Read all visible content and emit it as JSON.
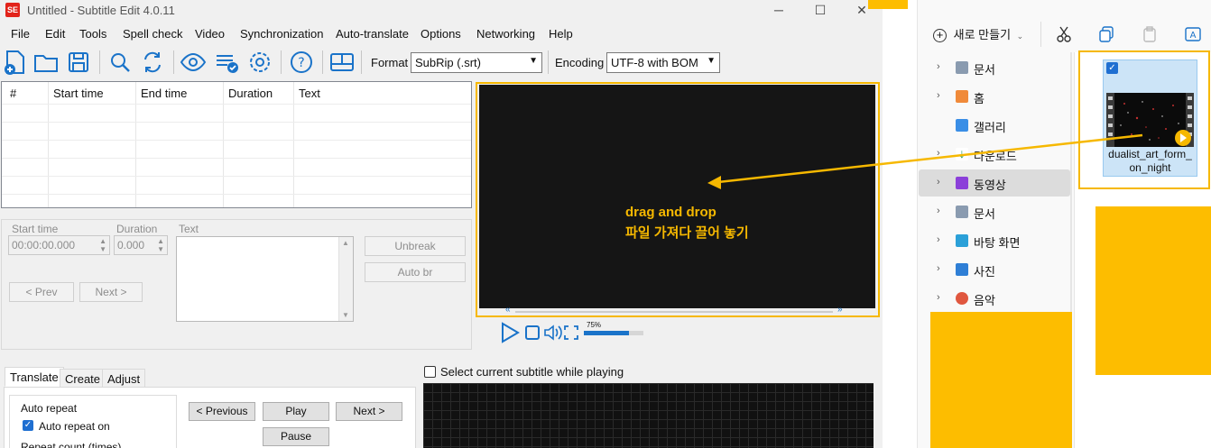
{
  "window": {
    "title": "Untitled - Subtitle Edit 4.0.11",
    "logo": "SE"
  },
  "menu": [
    "File",
    "Edit",
    "Tools",
    "Spell check",
    "Video",
    "Synchronization",
    "Auto-translate",
    "Options",
    "Networking",
    "Help"
  ],
  "toolbar": {
    "format_label": "Format",
    "format_value": "SubRip (.srt)",
    "encoding_label": "Encoding",
    "encoding_value": "UTF-8 with BOM"
  },
  "grid": {
    "headers": [
      "#",
      "Start time",
      "End time",
      "Duration",
      "Text"
    ]
  },
  "edit": {
    "start_time_label": "Start time",
    "start_time_value": "00:00:00.000",
    "duration_label": "Duration",
    "duration_value": "0.000",
    "text_label": "Text",
    "unbreak": "Unbreak",
    "auto_br": "Auto br",
    "prev": "< Prev",
    "next": "Next >"
  },
  "video": {
    "overlay_line1": "drag and drop",
    "overlay_line2": "파일 가져다 끌어 놓기",
    "volume": "75%",
    "volume_level": 0.75
  },
  "tabs": [
    "Translate",
    "Create",
    "Adjust"
  ],
  "translate": {
    "auto_repeat_group": "Auto repeat",
    "auto_repeat_on": "Auto repeat on",
    "repeat_count": "Repeat count (times)",
    "previous": "< Previous",
    "play": "Play",
    "next": "Next >",
    "pause": "Pause"
  },
  "waveform": {
    "select_current": "Select current subtitle while playing"
  },
  "explorer": {
    "new_button": "새로 만들기",
    "nav": [
      {
        "label": "문서",
        "expandable": true
      },
      {
        "label": "홈",
        "expandable": true
      },
      {
        "label": "갤러리",
        "expandable": false
      },
      {
        "label": "다운로드",
        "expandable": true
      },
      {
        "label": "동영상",
        "expandable": true,
        "selected": true
      },
      {
        "label": "문서",
        "expandable": true
      },
      {
        "label": "바탕 화면",
        "expandable": true
      },
      {
        "label": "사진",
        "expandable": true
      },
      {
        "label": "음악",
        "expandable": true
      }
    ],
    "file": {
      "name_line1": "dualist_art_form_",
      "name_line2": "on_night"
    }
  },
  "colors": {
    "highlight": "#f6b800",
    "accent": "#1f6fd1",
    "video_bg": "#151515"
  }
}
